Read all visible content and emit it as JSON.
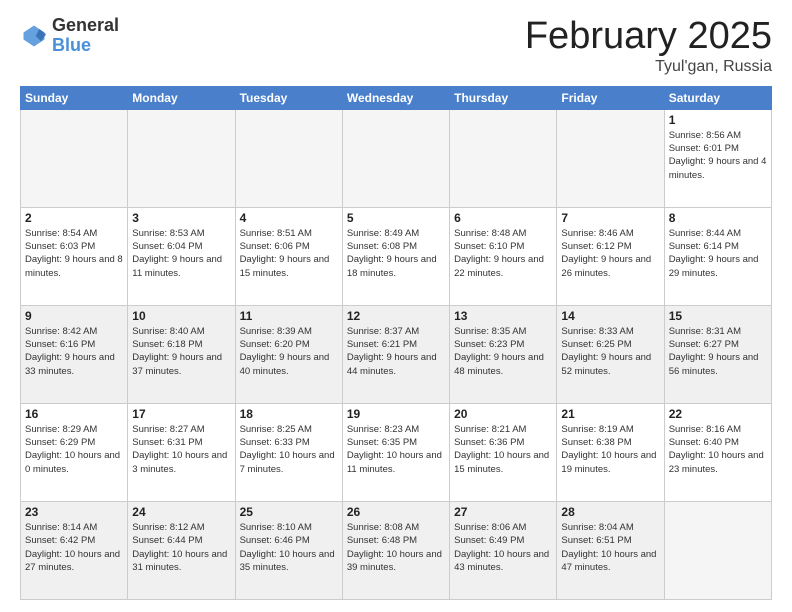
{
  "header": {
    "logo_general": "General",
    "logo_blue": "Blue",
    "month_title": "February 2025",
    "subtitle": "Tyul'gan, Russia"
  },
  "days_of_week": [
    "Sunday",
    "Monday",
    "Tuesday",
    "Wednesday",
    "Thursday",
    "Friday",
    "Saturday"
  ],
  "weeks": [
    [
      {
        "day": "",
        "empty": true
      },
      {
        "day": "",
        "empty": true
      },
      {
        "day": "",
        "empty": true
      },
      {
        "day": "",
        "empty": true
      },
      {
        "day": "",
        "empty": true
      },
      {
        "day": "",
        "empty": true
      },
      {
        "day": "1",
        "info": "Sunrise: 8:56 AM\nSunset: 6:01 PM\nDaylight: 9 hours and 4 minutes."
      }
    ],
    [
      {
        "day": "2",
        "info": "Sunrise: 8:54 AM\nSunset: 6:03 PM\nDaylight: 9 hours and 8 minutes."
      },
      {
        "day": "3",
        "info": "Sunrise: 8:53 AM\nSunset: 6:04 PM\nDaylight: 9 hours and 11 minutes."
      },
      {
        "day": "4",
        "info": "Sunrise: 8:51 AM\nSunset: 6:06 PM\nDaylight: 9 hours and 15 minutes."
      },
      {
        "day": "5",
        "info": "Sunrise: 8:49 AM\nSunset: 6:08 PM\nDaylight: 9 hours and 18 minutes."
      },
      {
        "day": "6",
        "info": "Sunrise: 8:48 AM\nSunset: 6:10 PM\nDaylight: 9 hours and 22 minutes."
      },
      {
        "day": "7",
        "info": "Sunrise: 8:46 AM\nSunset: 6:12 PM\nDaylight: 9 hours and 26 minutes."
      },
      {
        "day": "8",
        "info": "Sunrise: 8:44 AM\nSunset: 6:14 PM\nDaylight: 9 hours and 29 minutes."
      }
    ],
    [
      {
        "day": "9",
        "info": "Sunrise: 8:42 AM\nSunset: 6:16 PM\nDaylight: 9 hours and 33 minutes."
      },
      {
        "day": "10",
        "info": "Sunrise: 8:40 AM\nSunset: 6:18 PM\nDaylight: 9 hours and 37 minutes."
      },
      {
        "day": "11",
        "info": "Sunrise: 8:39 AM\nSunset: 6:20 PM\nDaylight: 9 hours and 40 minutes."
      },
      {
        "day": "12",
        "info": "Sunrise: 8:37 AM\nSunset: 6:21 PM\nDaylight: 9 hours and 44 minutes."
      },
      {
        "day": "13",
        "info": "Sunrise: 8:35 AM\nSunset: 6:23 PM\nDaylight: 9 hours and 48 minutes."
      },
      {
        "day": "14",
        "info": "Sunrise: 8:33 AM\nSunset: 6:25 PM\nDaylight: 9 hours and 52 minutes."
      },
      {
        "day": "15",
        "info": "Sunrise: 8:31 AM\nSunset: 6:27 PM\nDaylight: 9 hours and 56 minutes."
      }
    ],
    [
      {
        "day": "16",
        "info": "Sunrise: 8:29 AM\nSunset: 6:29 PM\nDaylight: 10 hours and 0 minutes."
      },
      {
        "day": "17",
        "info": "Sunrise: 8:27 AM\nSunset: 6:31 PM\nDaylight: 10 hours and 3 minutes."
      },
      {
        "day": "18",
        "info": "Sunrise: 8:25 AM\nSunset: 6:33 PM\nDaylight: 10 hours and 7 minutes."
      },
      {
        "day": "19",
        "info": "Sunrise: 8:23 AM\nSunset: 6:35 PM\nDaylight: 10 hours and 11 minutes."
      },
      {
        "day": "20",
        "info": "Sunrise: 8:21 AM\nSunset: 6:36 PM\nDaylight: 10 hours and 15 minutes."
      },
      {
        "day": "21",
        "info": "Sunrise: 8:19 AM\nSunset: 6:38 PM\nDaylight: 10 hours and 19 minutes."
      },
      {
        "day": "22",
        "info": "Sunrise: 8:16 AM\nSunset: 6:40 PM\nDaylight: 10 hours and 23 minutes."
      }
    ],
    [
      {
        "day": "23",
        "info": "Sunrise: 8:14 AM\nSunset: 6:42 PM\nDaylight: 10 hours and 27 minutes."
      },
      {
        "day": "24",
        "info": "Sunrise: 8:12 AM\nSunset: 6:44 PM\nDaylight: 10 hours and 31 minutes."
      },
      {
        "day": "25",
        "info": "Sunrise: 8:10 AM\nSunset: 6:46 PM\nDaylight: 10 hours and 35 minutes."
      },
      {
        "day": "26",
        "info": "Sunrise: 8:08 AM\nSunset: 6:48 PM\nDaylight: 10 hours and 39 minutes."
      },
      {
        "day": "27",
        "info": "Sunrise: 8:06 AM\nSunset: 6:49 PM\nDaylight: 10 hours and 43 minutes."
      },
      {
        "day": "28",
        "info": "Sunrise: 8:04 AM\nSunset: 6:51 PM\nDaylight: 10 hours and 47 minutes."
      },
      {
        "day": "",
        "empty": true
      }
    ]
  ]
}
